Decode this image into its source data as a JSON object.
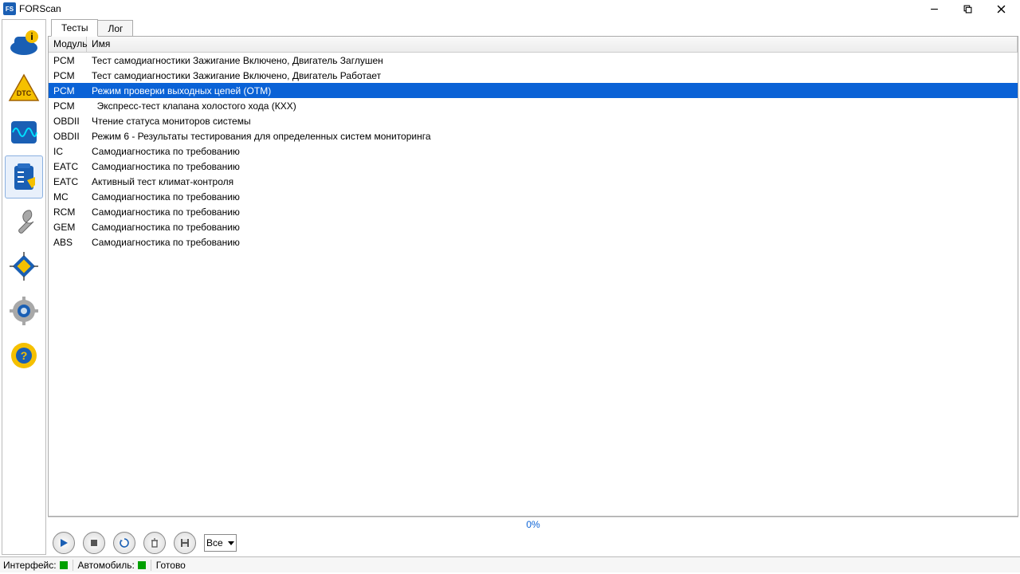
{
  "window": {
    "title": "FORScan"
  },
  "tabs": [
    {
      "label": "Тесты",
      "active": true
    },
    {
      "label": "Лог",
      "active": false
    }
  ],
  "columns": {
    "module": "Модуль",
    "name": "Имя"
  },
  "rows": [
    {
      "module": "PCM",
      "name": "Тест самодиагностики Зажигание Включено, Двигатель Заглушен",
      "selected": false
    },
    {
      "module": "PCM",
      "name": "Тест самодиагностики Зажигание Включено, Двигатель Работает",
      "selected": false
    },
    {
      "module": "PCM",
      "name": "Режим проверки выходных цепей (OTM)",
      "selected": true
    },
    {
      "module": "PCM",
      "name": "  Экспресс-тест клапана холостого хода (КХХ)",
      "selected": false
    },
    {
      "module": "OBDII",
      "name": "Чтение статуса мониторов системы",
      "selected": false
    },
    {
      "module": "OBDII",
      "name": "Режим 6 - Результаты тестирования для определенных систем мониторинга",
      "selected": false
    },
    {
      "module": "IC",
      "name": "Самодиагностика по требованию",
      "selected": false
    },
    {
      "module": "EATC",
      "name": "Самодиагностика по требованию",
      "selected": false
    },
    {
      "module": "EATC",
      "name": "Активный тест климат-контроля",
      "selected": false
    },
    {
      "module": "MC",
      "name": "Самодиагностика по требованию",
      "selected": false
    },
    {
      "module": "RCM",
      "name": "Самодиагностика по требованию",
      "selected": false
    },
    {
      "module": "GEM",
      "name": "Самодиагностика по требованию",
      "selected": false
    },
    {
      "module": "ABS",
      "name": "Самодиагностика по требованию",
      "selected": false
    }
  ],
  "progress": "0%",
  "filter_select": "Все",
  "status": {
    "interface": "Интерфейс:",
    "vehicle": "Автомобиль:",
    "ready": "Готово"
  }
}
